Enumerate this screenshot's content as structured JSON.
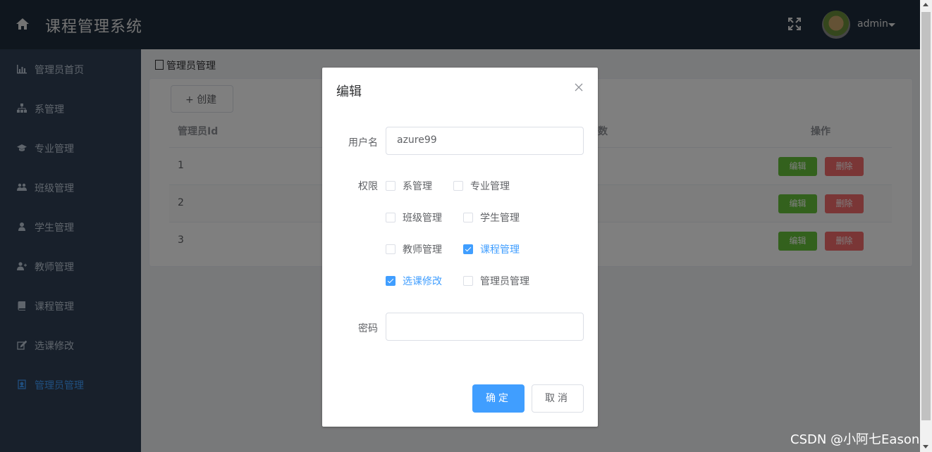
{
  "header": {
    "title": "课程管理系统",
    "user": "admin"
  },
  "sidebar": {
    "items": [
      {
        "label": "管理员首页",
        "icon": "bar-chart-icon"
      },
      {
        "label": "系管理",
        "icon": "sitemap-icon"
      },
      {
        "label": "专业管理",
        "icon": "graduation-cap-icon"
      },
      {
        "label": "班级管理",
        "icon": "users-icon"
      },
      {
        "label": "学生管理",
        "icon": "user-icon"
      },
      {
        "label": "教师管理",
        "icon": "user-plus-icon"
      },
      {
        "label": "课程管理",
        "icon": "book-icon"
      },
      {
        "label": "选课修改",
        "icon": "edit-icon"
      },
      {
        "label": "管理员管理",
        "icon": "badge-icon",
        "active": true
      }
    ]
  },
  "main": {
    "breadcrumb": "管理员管理",
    "create_label": "创建",
    "columns": {
      "id": "管理员Id",
      "partial": "数",
      "ops": "操作"
    },
    "rows": [
      {
        "id": "1"
      },
      {
        "id": "2"
      },
      {
        "id": "3"
      }
    ],
    "edit_label": "编辑",
    "delete_label": "删除"
  },
  "dialog": {
    "title": "编辑",
    "username_label": "用户名",
    "username_value": "azure99",
    "perm_label": "权限",
    "permissions": [
      {
        "label": "系管理",
        "checked": false
      },
      {
        "label": "专业管理",
        "checked": false
      },
      {
        "label": "班级管理",
        "checked": false
      },
      {
        "label": "学生管理",
        "checked": false
      },
      {
        "label": "教师管理",
        "checked": false
      },
      {
        "label": "课程管理",
        "checked": true
      },
      {
        "label": "选课修改",
        "checked": true
      },
      {
        "label": "管理员管理",
        "checked": false
      }
    ],
    "password_label": "密码",
    "password_value": "",
    "ok_label": "确定",
    "cancel_label": "取消"
  },
  "watermark": "CSDN @小阿七Eason",
  "colors": {
    "header": "#1f2d3d",
    "sidebar": "#304156",
    "primary": "#409eff",
    "success": "#67c23a",
    "danger": "#f56c6c"
  }
}
